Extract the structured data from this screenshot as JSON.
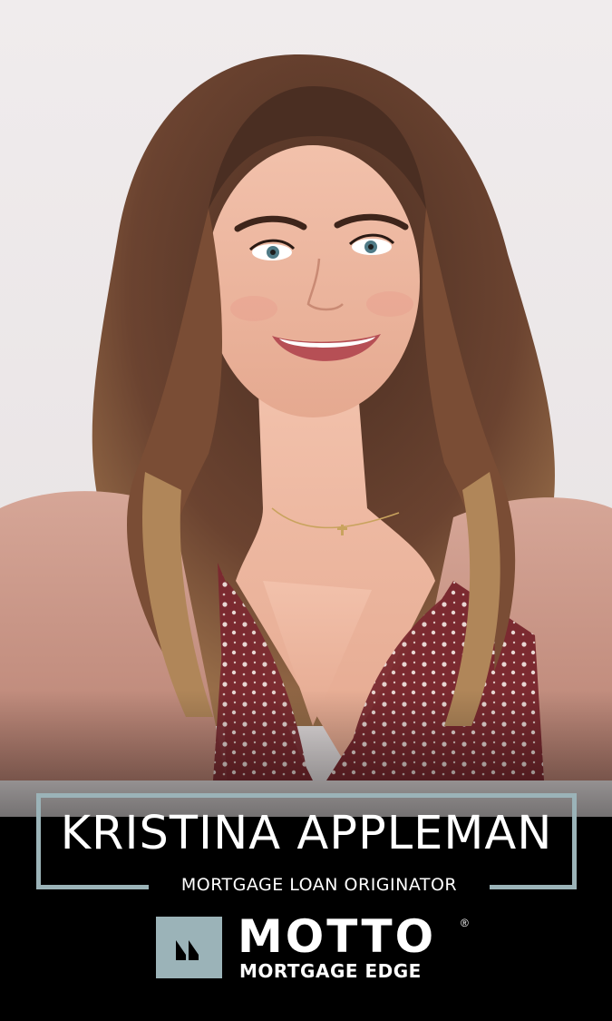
{
  "agent": {
    "name": "KRISTINA APPLEMAN",
    "title": "MORTGAGE LOAN ORIGINATOR"
  },
  "brand": {
    "name": "MOTTO",
    "registered_mark": "®",
    "subtitle": "MORTGAGE EDGE",
    "logo_icon": "motto-logo-icon"
  },
  "colors": {
    "frame": "#9bb3b8",
    "logo_mark": "#9bb3b8",
    "text": "#ffffff",
    "background_bottom": "#000000",
    "wall": "#ece8e9"
  }
}
